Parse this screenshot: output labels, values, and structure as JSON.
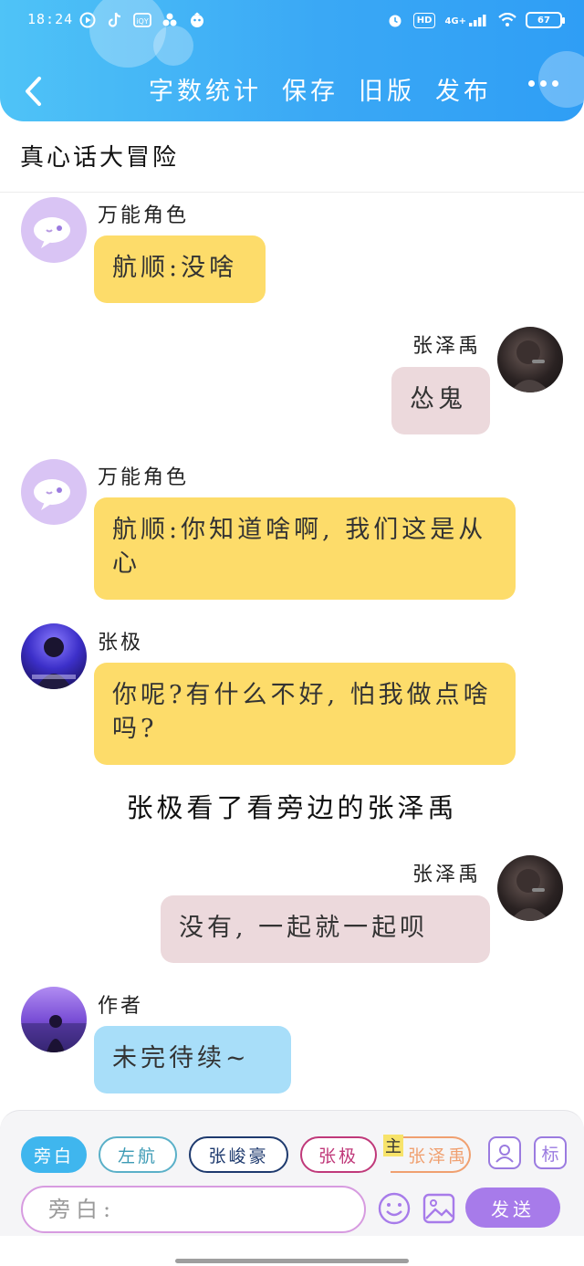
{
  "status_bar": {
    "time": "18:24",
    "network": "4G+",
    "hd": "HD",
    "battery": "67",
    "app_icons": [
      "video-app-icon",
      "tiktok-icon",
      "iqiyi-icon",
      "fan-app-icon",
      "game-app-icon"
    ]
  },
  "nav": {
    "back_icon": "chevron-left-icon",
    "actions": [
      "字数统计",
      "保存",
      "旧版",
      "发布"
    ],
    "more_icon": "more-dots-icon"
  },
  "story": {
    "title": "真心话大冒险"
  },
  "messages": [
    {
      "side": "left",
      "speaker": "万能角色",
      "text": "航顺:没啥",
      "color": "#fddc6a"
    },
    {
      "side": "right",
      "speaker": "张泽禹",
      "text": "怂鬼",
      "color": "#ecd9dc"
    },
    {
      "side": "left",
      "speaker": "万能角色",
      "text": "航顺:你知道啥啊, 我们这是从心",
      "color": "#fddc6a"
    },
    {
      "side": "left",
      "speaker": "张极",
      "text": "你呢?有什么不好, 怕我做点啥吗?",
      "color": "#fddc6a"
    },
    {
      "side": "right",
      "speaker": "张泽禹",
      "text": "没有, 一起就一起呗",
      "color": "#ecd9dc"
    },
    {
      "side": "left",
      "speaker": "作者",
      "text": "未完待续~",
      "color": "#a8def9"
    }
  ],
  "narration": "张极看了看旁边的张泽禹",
  "composer": {
    "roles": [
      {
        "label": "旁白",
        "selected": true,
        "color": "#3fb6ee"
      },
      {
        "label": "左航",
        "selected": false,
        "color": "#5ab0c8"
      },
      {
        "label": "张峻豪",
        "selected": false,
        "color": "#1e3a6e"
      },
      {
        "label": "张极",
        "selected": false,
        "color": "#c0397a"
      },
      {
        "label": "张泽禹",
        "selected": false,
        "color": "#f0a070"
      }
    ],
    "main_badge": "主",
    "tag_button": "标",
    "input_placeholder": "旁白:",
    "send_label": "发送",
    "accent": "#a77bea"
  }
}
